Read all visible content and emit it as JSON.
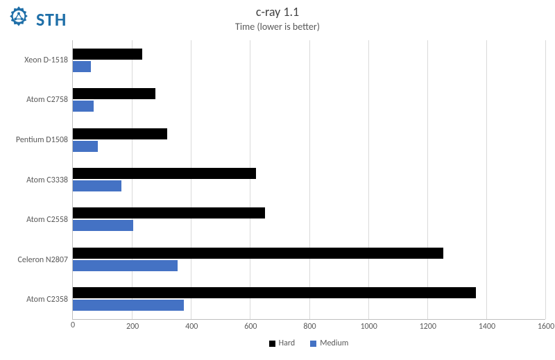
{
  "logo_text": "STH",
  "chart_data": {
    "type": "bar",
    "orientation": "horizontal",
    "title": "c-ray 1.1",
    "subtitle": "Time (lower is better)",
    "xlabel": "",
    "ylabel": "",
    "xlim": [
      0,
      1600
    ],
    "x_ticks": [
      0,
      200,
      400,
      600,
      800,
      1000,
      1200,
      1400,
      1600
    ],
    "categories": [
      "Xeon D-1518",
      "Atom C2758",
      "Pentium D1508",
      "Atom C3338",
      "Atom C2558",
      "Celeron N2807",
      "Atom C2358"
    ],
    "series": [
      {
        "name": "Hard",
        "color": "#000000",
        "values": [
          235,
          280,
          320,
          620,
          650,
          1255,
          1365
        ]
      },
      {
        "name": "Medium",
        "color": "#4472c4",
        "values": [
          60,
          70,
          85,
          165,
          205,
          355,
          375
        ]
      }
    ],
    "legend": {
      "position": "bottom",
      "items": [
        "Hard",
        "Medium"
      ]
    }
  }
}
